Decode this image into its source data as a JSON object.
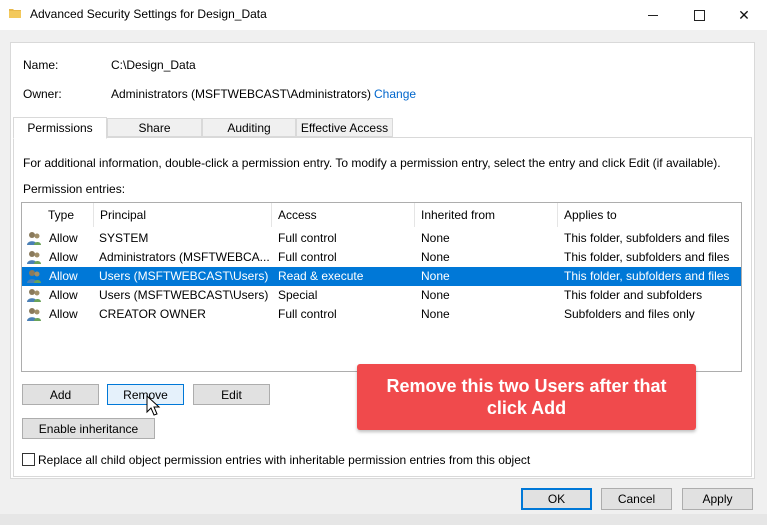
{
  "window": {
    "title": "Advanced Security Settings for Design_Data",
    "minimize_icon": "minimize-icon",
    "maximize_icon": "maximize-icon",
    "close_icon": "close-icon"
  },
  "info": {
    "name_label": "Name:",
    "name_value": "C:\\Design_Data",
    "owner_label": "Owner:",
    "owner_value": "Administrators (MSFTWEBCAST\\Administrators)",
    "change_link": "Change"
  },
  "tabs": [
    {
      "label": "Permissions",
      "active": true
    },
    {
      "label": "Share",
      "active": false
    },
    {
      "label": "Auditing",
      "active": false
    },
    {
      "label": "Effective Access",
      "active": false
    }
  ],
  "permissions": {
    "description": "For additional information, double-click a permission entry. To modify a permission entry, select the entry and click Edit (if available).",
    "entries_label": "Permission entries:",
    "columns": [
      "Type",
      "Principal",
      "Access",
      "Inherited from",
      "Applies to"
    ],
    "rows": [
      {
        "type": "Allow",
        "principal": "SYSTEM",
        "access": "Full control",
        "inherited": "None",
        "applies": "This folder, subfolders and files",
        "selected": false
      },
      {
        "type": "Allow",
        "principal": "Administrators (MSFTWEBCA...",
        "access": "Full control",
        "inherited": "None",
        "applies": "This folder, subfolders and files",
        "selected": false
      },
      {
        "type": "Allow",
        "principal": "Users (MSFTWEBCAST\\Users)",
        "access": "Read & execute",
        "inherited": "None",
        "applies": "This folder, subfolders and files",
        "selected": true
      },
      {
        "type": "Allow",
        "principal": "Users (MSFTWEBCAST\\Users)",
        "access": "Special",
        "inherited": "None",
        "applies": "This folder and subfolders",
        "selected": false
      },
      {
        "type": "Allow",
        "principal": "CREATOR OWNER",
        "access": "Full control",
        "inherited": "None",
        "applies": "Subfolders and files only",
        "selected": false
      }
    ],
    "add_button": "Add",
    "remove_button": "Remove",
    "edit_button": "Edit",
    "enable_inheritance_button": "Enable inheritance",
    "replace_checkbox_label": "Replace all child object permission entries with inheritable permission entries from this object",
    "replace_checked": false
  },
  "callout": {
    "line1": "Remove this two Users after that",
    "line2": "click Add",
    "color": "#f04a4c"
  },
  "footer": {
    "ok_button": "OK",
    "cancel_button": "Cancel",
    "apply_button": "Apply"
  },
  "colors": {
    "selection": "#0078d7",
    "link": "#0066cc"
  }
}
